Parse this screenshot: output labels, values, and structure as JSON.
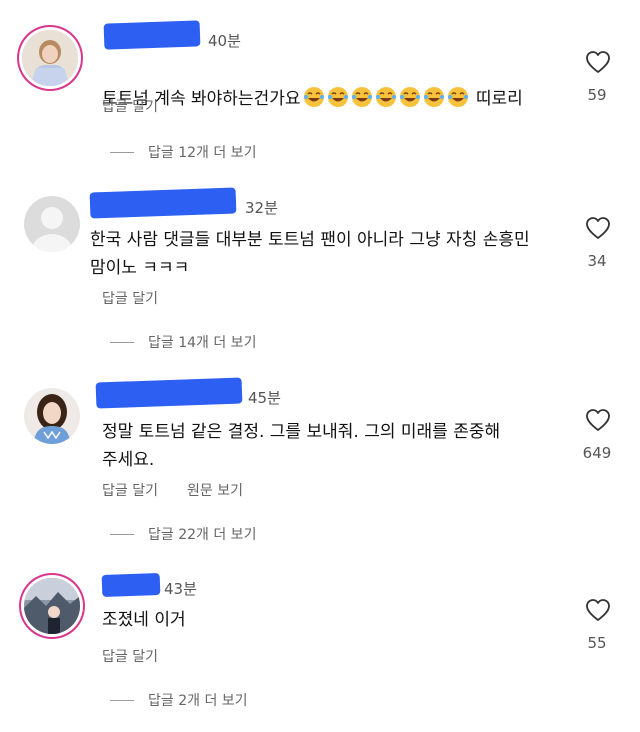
{
  "comments": [
    {
      "time": "40분",
      "text_before": "토트넘 계속 봐야하는건가요",
      "laugh_emoji_count": 7,
      "text_after": "띠로리",
      "reply": "답글 달기",
      "likes": "59",
      "more_replies": "답글 12개 더 보기",
      "avatar_ring": true
    },
    {
      "time": "32분",
      "text": "한국 사람 댓글들 대부분 토트넘 팬이 아니라 그냥 자칭 손흥민\n맘이노 ㅋㅋㅋ",
      "reply": "답글 달기",
      "likes": "34",
      "more_replies": "답글 14개 더 보기",
      "avatar_ring": false
    },
    {
      "time": "45분",
      "text": "정말 토트넘 같은 결정. 그를 보내줘. 그의 미래를 존중해\n주세요.",
      "reply": "답글 달기",
      "original": "원문 보기",
      "likes": "649",
      "more_replies": "답글 22개 더 보기",
      "avatar_ring": false
    },
    {
      "time": "43분",
      "text": "조졌네 이거",
      "reply": "답글 달기",
      "likes": "55",
      "more_replies": "답글 2개 더 보기",
      "avatar_ring": true
    }
  ],
  "icons": {
    "heart": "heart-outline-icon",
    "laugh": "face-with-tears-of-joy-icon"
  },
  "colors": {
    "redaction": "#2c5ff2",
    "story_ring": "#d9368d"
  }
}
